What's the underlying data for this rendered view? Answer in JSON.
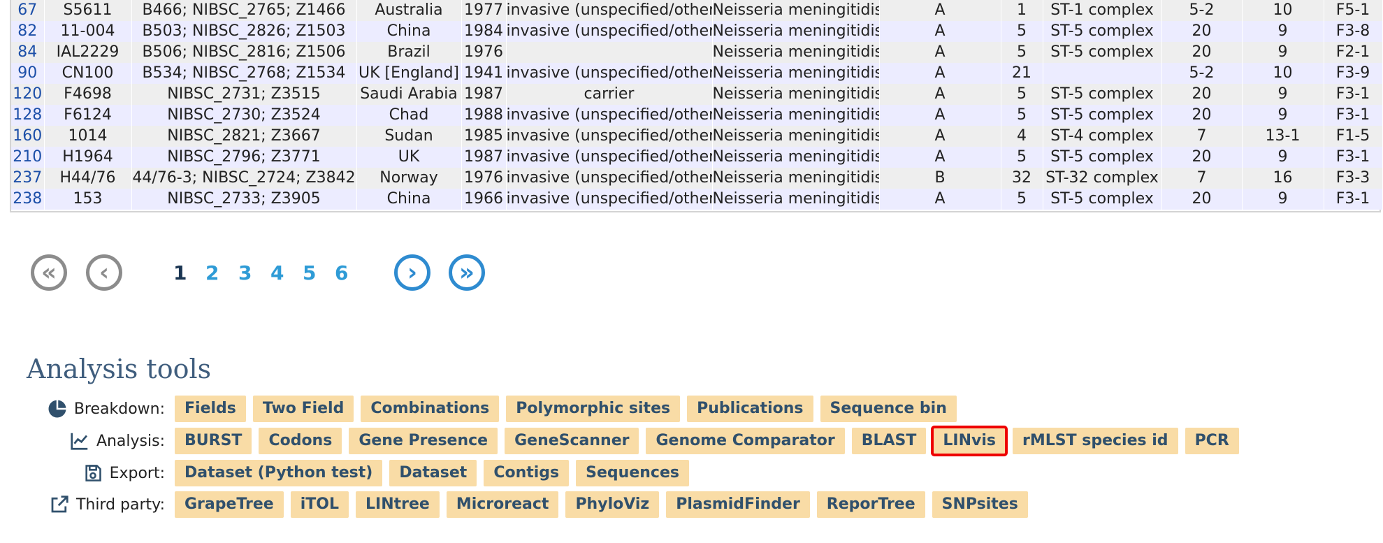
{
  "table": {
    "rows": [
      [
        "67",
        "S5611",
        "B466; NIBSC_2765; Z1466",
        "Australia",
        "1977",
        "invasive (unspecified/other)",
        "Neisseria meningitidis",
        "A",
        "1",
        "ST-1 complex",
        "5-2",
        "10",
        "F5-1"
      ],
      [
        "82",
        "11-004",
        "B503; NIBSC_2826; Z1503",
        "China",
        "1984",
        "invasive (unspecified/other)",
        "Neisseria meningitidis",
        "A",
        "5",
        "ST-5 complex",
        "20",
        "9",
        "F3-8"
      ],
      [
        "84",
        "IAL2229",
        "B506; NIBSC_2816; Z1506",
        "Brazil",
        "1976",
        "",
        "Neisseria meningitidis",
        "A",
        "5",
        "ST-5 complex",
        "20",
        "9",
        "F2-1"
      ],
      [
        "90",
        "CN100",
        "B534; NIBSC_2768; Z1534",
        "UK [England]",
        "1941",
        "invasive (unspecified/other)",
        "Neisseria meningitidis",
        "A",
        "21",
        "",
        "5-2",
        "10",
        "F3-9"
      ],
      [
        "120",
        "F4698",
        "NIBSC_2731; Z3515",
        "Saudi Arabia",
        "1987",
        "carrier",
        "Neisseria meningitidis",
        "A",
        "5",
        "ST-5 complex",
        "20",
        "9",
        "F3-1"
      ],
      [
        "128",
        "F6124",
        "NIBSC_2730; Z3524",
        "Chad",
        "1988",
        "invasive (unspecified/other)",
        "Neisseria meningitidis",
        "A",
        "5",
        "ST-5 complex",
        "20",
        "9",
        "F3-1"
      ],
      [
        "160",
        "1014",
        "NIBSC_2821; Z3667",
        "Sudan",
        "1985",
        "invasive (unspecified/other)",
        "Neisseria meningitidis",
        "A",
        "4",
        "ST-4 complex",
        "7",
        "13-1",
        "F1-5"
      ],
      [
        "210",
        "H1964",
        "NIBSC_2796; Z3771",
        "UK",
        "1987",
        "invasive (unspecified/other)",
        "Neisseria meningitidis",
        "A",
        "5",
        "ST-5 complex",
        "20",
        "9",
        "F3-1"
      ],
      [
        "237",
        "H44/76",
        "44/76-3; NIBSC_2724; Z3842",
        "Norway",
        "1976",
        "invasive (unspecified/other)",
        "Neisseria meningitidis",
        "B",
        "32",
        "ST-32 complex",
        "7",
        "16",
        "F3-3"
      ],
      [
        "238",
        "153",
        "NIBSC_2733; Z3905",
        "China",
        "1966",
        "invasive (unspecified/other)",
        "Neisseria meningitidis",
        "A",
        "5",
        "ST-5 complex",
        "20",
        "9",
        "F3-1"
      ]
    ]
  },
  "pager": {
    "first_glyph": "«",
    "prev_glyph": "‹",
    "next_glyph": "›",
    "last_glyph": "»",
    "pages": [
      "1",
      "2",
      "3",
      "4",
      "5",
      "6"
    ],
    "current": "1"
  },
  "analysis": {
    "title": "Analysis tools",
    "rows": [
      {
        "label": "Breakdown:",
        "icon": "pie-chart-icon",
        "tools": [
          "Fields",
          "Two Field",
          "Combinations",
          "Polymorphic sites",
          "Publications",
          "Sequence bin"
        ]
      },
      {
        "label": "Analysis:",
        "icon": "line-chart-icon",
        "tools": [
          "BURST",
          "Codons",
          "Gene Presence",
          "GeneScanner",
          "Genome Comparator",
          "BLAST",
          "LINvis",
          "rMLST species id",
          "PCR"
        ]
      },
      {
        "label": "Export:",
        "icon": "save-icon",
        "tools": [
          "Dataset (Python test)",
          "Dataset",
          "Contigs",
          "Sequences"
        ]
      },
      {
        "label": "Third party:",
        "icon": "external-link-icon",
        "tools": [
          "GrapeTree",
          "iTOL",
          "LINtree",
          "Microreact",
          "PhyloViz",
          "PlasmidFinder",
          "ReporTree",
          "SNPsites"
        ]
      }
    ],
    "highlighted_tool": "LINvis",
    "colors": {
      "tool_bg": "#f9dca6",
      "tool_text": "#30506c",
      "highlight": "#ee0000"
    }
  }
}
